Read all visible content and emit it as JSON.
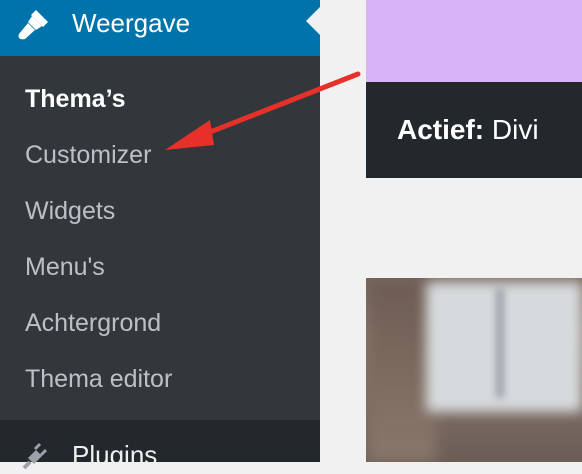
{
  "sidebar": {
    "current_menu": {
      "label": "Weergave",
      "icon": "paintbrush-icon"
    },
    "submenu": [
      {
        "label": "Thema’s",
        "current": true
      },
      {
        "label": "Customizer",
        "current": false
      },
      {
        "label": "Widgets",
        "current": false
      },
      {
        "label": "Menu's",
        "current": false
      },
      {
        "label": "Achtergrond",
        "current": false
      },
      {
        "label": "Thema editor",
        "current": false
      }
    ],
    "next_menu": {
      "label": "Plugins",
      "icon": "plug-icon"
    }
  },
  "theme": {
    "active_label": "Actief:",
    "active_name": "Divi"
  },
  "colors": {
    "sidebar_bg": "#32373c",
    "current_menu_bg": "#0073aa",
    "theme_preview": "#d8b4f7",
    "annotation_arrow": "#e8302a"
  }
}
